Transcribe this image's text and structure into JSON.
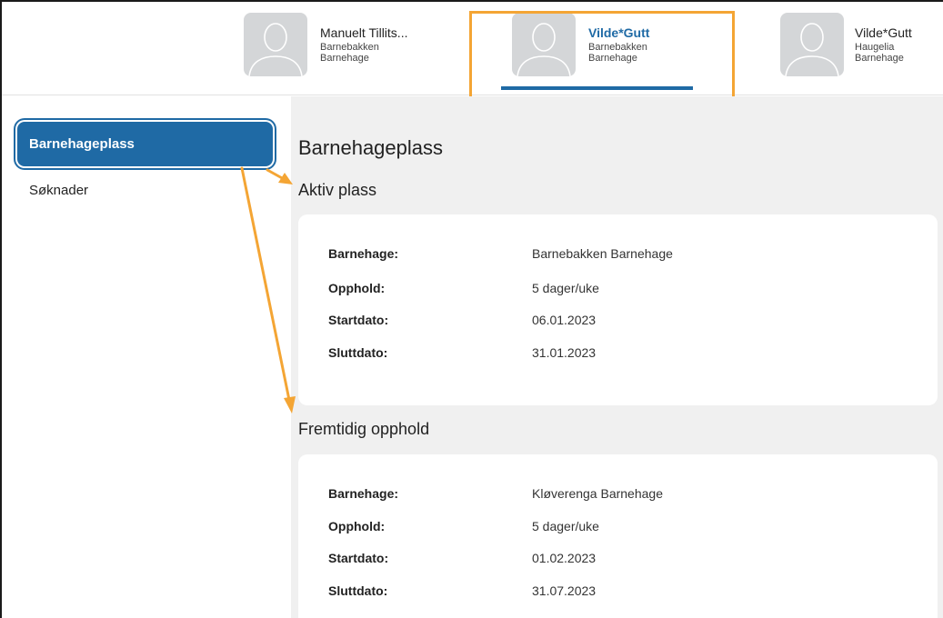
{
  "header": {
    "children": [
      {
        "name": "Manuelt Tillits...",
        "kindergarten": "Barnebakken",
        "type": "Barnehage",
        "active": false
      },
      {
        "name": "Vilde*Gutt",
        "kindergarten": "Barnebakken",
        "type": "Barnehage",
        "active": true
      },
      {
        "name": "Vilde*Gutt",
        "kindergarten": "Haugelia",
        "type": "Barnehage",
        "active": false
      }
    ]
  },
  "sidebar": {
    "items": [
      {
        "label": "Barnehageplass",
        "active": true
      },
      {
        "label": "Søknader",
        "active": false
      }
    ]
  },
  "main": {
    "title": "Barnehageplass",
    "sections": [
      {
        "title": "Aktiv plass",
        "rows": [
          {
            "label": "Barnehage:",
            "value": "Barnebakken Barnehage"
          },
          {
            "label": "Opphold:",
            "value": "5 dager/uke"
          },
          {
            "label": "Startdato:",
            "value": "06.01.2023"
          },
          {
            "label": "Sluttdato:",
            "value": "31.01.2023"
          }
        ]
      },
      {
        "title": "Fremtidig opphold",
        "rows": [
          {
            "label": "Barnehage:",
            "value": "Kløverenga Barnehage"
          },
          {
            "label": "Opphold:",
            "value": "5 dager/uke"
          },
          {
            "label": "Startdato:",
            "value": "01.02.2023"
          },
          {
            "label": "Sluttdato:",
            "value": "31.07.2023"
          }
        ]
      }
    ]
  },
  "colors": {
    "accent": "#1f6aa5",
    "annotation": "#f4a534",
    "main_background": "#f0f0f0"
  },
  "icons": {
    "avatar": "person-silhouette-icon"
  }
}
